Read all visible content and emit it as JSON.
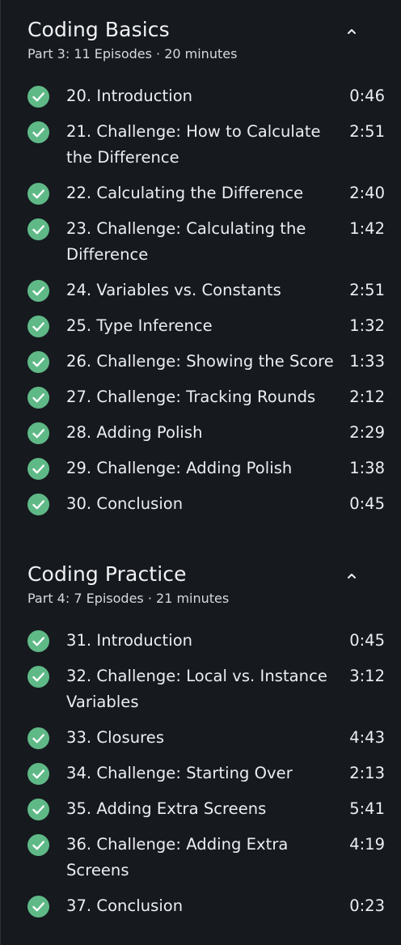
{
  "sections": [
    {
      "title": "Coding Basics",
      "meta": "Part 3: 11 Episodes · 20 minutes",
      "toggle_icon": "chevron-up-icon",
      "episodes": [
        {
          "title": "20. Introduction",
          "duration": "0:46",
          "completed": true
        },
        {
          "title": "21. Challenge: How to Calculate the Difference",
          "duration": "2:51",
          "completed": true
        },
        {
          "title": "22. Calculating the Difference",
          "duration": "2:40",
          "completed": true
        },
        {
          "title": "23. Challenge: Calculating the Difference",
          "duration": "1:42",
          "completed": true
        },
        {
          "title": "24. Variables vs. Constants",
          "duration": "2:51",
          "completed": true
        },
        {
          "title": "25. Type Inference",
          "duration": "1:32",
          "completed": true
        },
        {
          "title": "26. Challenge: Showing the Score",
          "duration": "1:33",
          "completed": true
        },
        {
          "title": "27. Challenge: Tracking Rounds",
          "duration": "2:12",
          "completed": true
        },
        {
          "title": "28. Adding Polish",
          "duration": "2:29",
          "completed": true
        },
        {
          "title": "29. Challenge: Adding Polish",
          "duration": "1:38",
          "completed": true
        },
        {
          "title": "30. Conclusion",
          "duration": "0:45",
          "completed": true
        }
      ]
    },
    {
      "title": "Coding Practice",
      "meta": "Part 4: 7 Episodes · 21 minutes",
      "toggle_icon": "chevron-up-icon",
      "episodes": [
        {
          "title": "31. Introduction",
          "duration": "0:45",
          "completed": true
        },
        {
          "title": "32. Challenge: Local vs. Instance Variables",
          "duration": "3:12",
          "completed": true
        },
        {
          "title": "33. Closures",
          "duration": "4:43",
          "completed": true
        },
        {
          "title": "34. Challenge: Starting Over",
          "duration": "2:13",
          "completed": true
        },
        {
          "title": "35. Adding Extra Screens",
          "duration": "5:41",
          "completed": true
        },
        {
          "title": "36. Challenge: Adding Extra Screens",
          "duration": "4:19",
          "completed": true
        },
        {
          "title": "37. Conclusion",
          "duration": "0:23",
          "completed": true
        }
      ]
    }
  ],
  "colors": {
    "background": "#16191e",
    "text": "#eceef1",
    "check_fill": "#5fb987",
    "check_mark": "#ffffff"
  }
}
